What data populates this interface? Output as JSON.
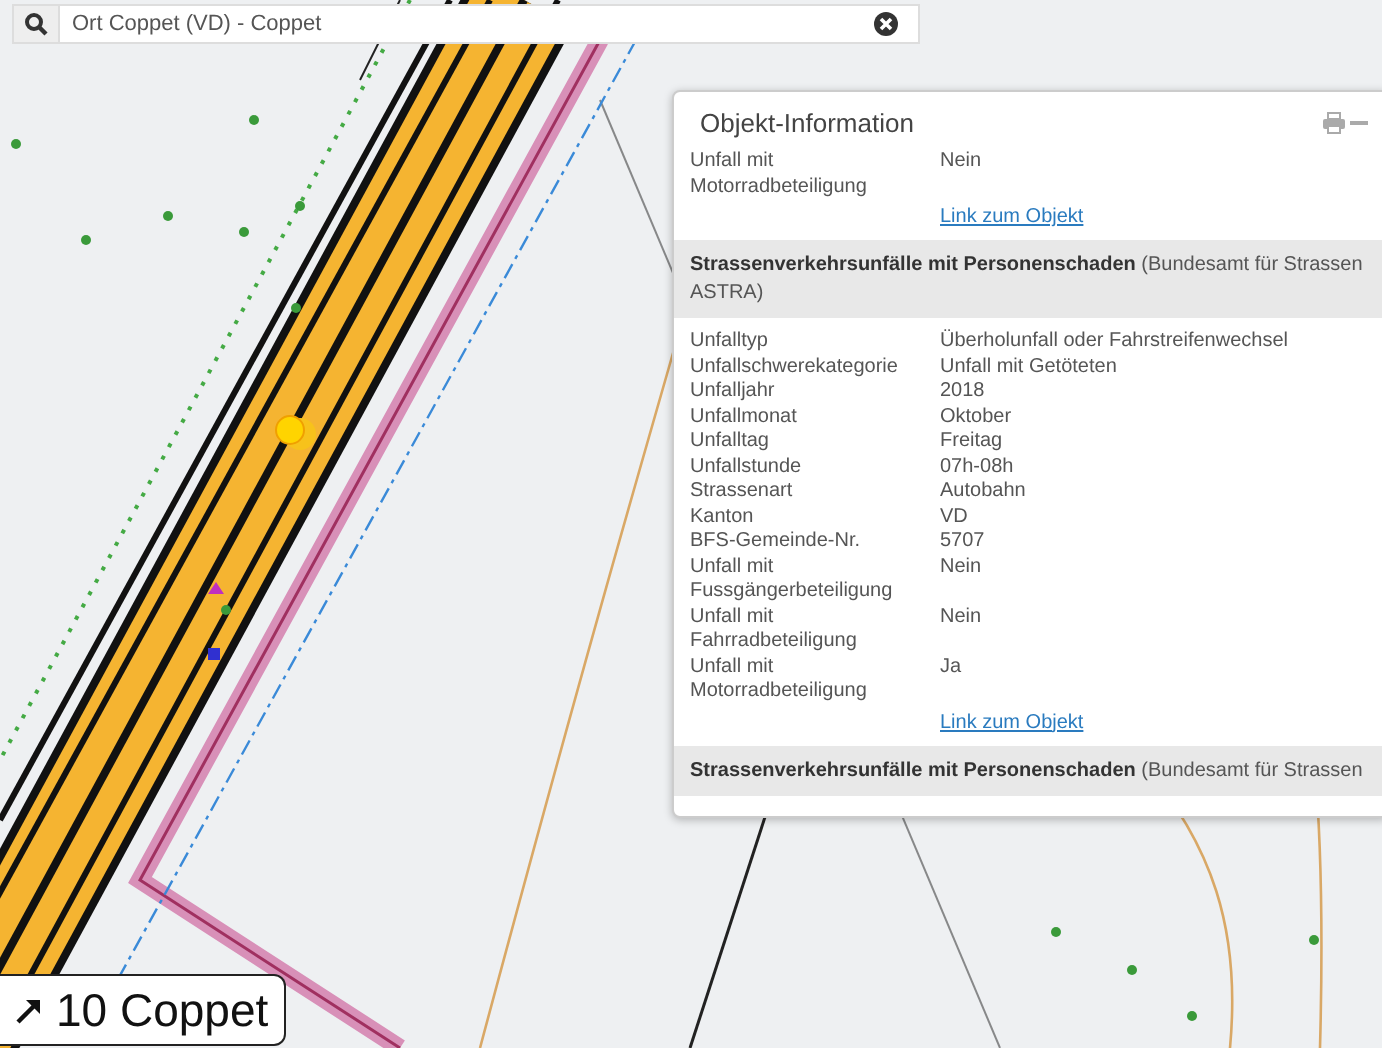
{
  "search": {
    "value": "Ort Coppet (VD) - Coppet"
  },
  "panel": {
    "title": "Objekt-Information",
    "sections": [
      {
        "rows": [
          {
            "label": "Unfall mit Motorradbeteiligung",
            "value": "Nein"
          }
        ],
        "link": "Link zum Objekt"
      },
      {
        "heading": "**Strassenverkehrsunfälle mit Personenschaden** (Bundesamt für Strassen ASTRA)",
        "rows": [
          {
            "label": "Unfalltyp",
            "value": "Überholunfall oder Fahrstreifenwechsel"
          },
          {
            "label": "Unfallschwerekategorie",
            "value": "Unfall mit Getöteten"
          },
          {
            "label": "Unfalljahr",
            "value": "2018"
          },
          {
            "label": "Unfallmonat",
            "value": "Oktober"
          },
          {
            "label": "Unfalltag",
            "value": "Freitag"
          },
          {
            "label": "Unfallstunde",
            "value": "07h-08h"
          },
          {
            "label": "Strassenart",
            "value": "Autobahn"
          },
          {
            "label": "Kanton",
            "value": "VD"
          },
          {
            "label": "BFS-Gemeinde-Nr.",
            "value": "5707"
          },
          {
            "label": "Unfall mit Fussgängerbeteiligung",
            "value": "Nein"
          },
          {
            "label": "Unfall mit Fahrradbeteiligung",
            "value": "Nein"
          },
          {
            "label": "Unfall mit Motorradbeteiligung",
            "value": "Ja"
          }
        ],
        "link": "Link zum Objekt"
      },
      {
        "heading": "**Strassenverkehrsunfälle mit Personenschaden** (Bundesamt für Strassen"
      }
    ]
  },
  "road_sign": {
    "label": "10 Coppet"
  }
}
